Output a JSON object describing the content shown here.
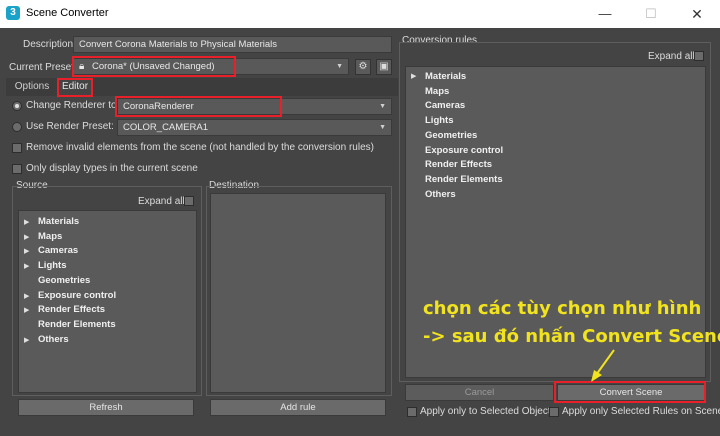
{
  "window": {
    "title": "Scene Converter",
    "app_icon_glyph": "3",
    "minimize_glyph": "—",
    "maximize_glyph": "☐",
    "close_glyph": "✕"
  },
  "left": {
    "description_label": "Description",
    "description_value": "Convert Corona Materials to Physical Materials",
    "preset_label": "Current Preset",
    "preset_value": "Corona* (Unsaved Changed)",
    "tabs": [
      "Options",
      "Editor"
    ],
    "change_renderer_label": "Change Renderer to:",
    "change_renderer_value": "CoronaRenderer",
    "use_preset_label": "Use Render Preset:",
    "use_preset_value": "COLOR_CAMERA1",
    "remove_invalid_label": "Remove invalid elements from the scene (not handled by the conversion rules)",
    "only_display_label": "Only display types in the current scene",
    "source_label": "Source",
    "destination_label": "Destination",
    "expand_all_label": "Expand all",
    "source_items": [
      {
        "label": "Materials",
        "arrow": true
      },
      {
        "label": "Maps",
        "arrow": true
      },
      {
        "label": "Cameras",
        "arrow": true
      },
      {
        "label": "Lights",
        "arrow": true
      },
      {
        "label": "Geometries",
        "arrow": false
      },
      {
        "label": "Exposure control",
        "arrow": true
      },
      {
        "label": "Render Effects",
        "arrow": true
      },
      {
        "label": "Render Elements",
        "arrow": false
      },
      {
        "label": "Others",
        "arrow": true
      }
    ],
    "refresh_label": "Refresh",
    "add_rule_label": "Add rule"
  },
  "right": {
    "conversion_rules_label": "Conversion rules",
    "expand_all_label": "Expand all",
    "rule_items": [
      {
        "label": "Materials",
        "arrow": true
      },
      {
        "label": "Maps",
        "arrow": false
      },
      {
        "label": "Cameras",
        "arrow": false
      },
      {
        "label": "Lights",
        "arrow": false
      },
      {
        "label": "Geometries",
        "arrow": false
      },
      {
        "label": "Exposure control",
        "arrow": false
      },
      {
        "label": "Render Effects",
        "arrow": false
      },
      {
        "label": "Render Elements",
        "arrow": false
      },
      {
        "label": "Others",
        "arrow": false
      }
    ],
    "cancel_label": "Cancel",
    "convert_label": "Convert Scene",
    "apply_selected_objects_label": "Apply only to Selected Objects",
    "apply_selected_rules_label": "Apply only Selected Rules on Scene"
  },
  "annotation": {
    "line1": "chọn các tùy chọn như hình",
    "line2": "-> sau đó nhấn Convert Scene",
    "color": "#f2e31f"
  },
  "colors": {
    "highlight_box": "#e8202a",
    "panel": "#444444",
    "list": "#5a5a5a"
  }
}
